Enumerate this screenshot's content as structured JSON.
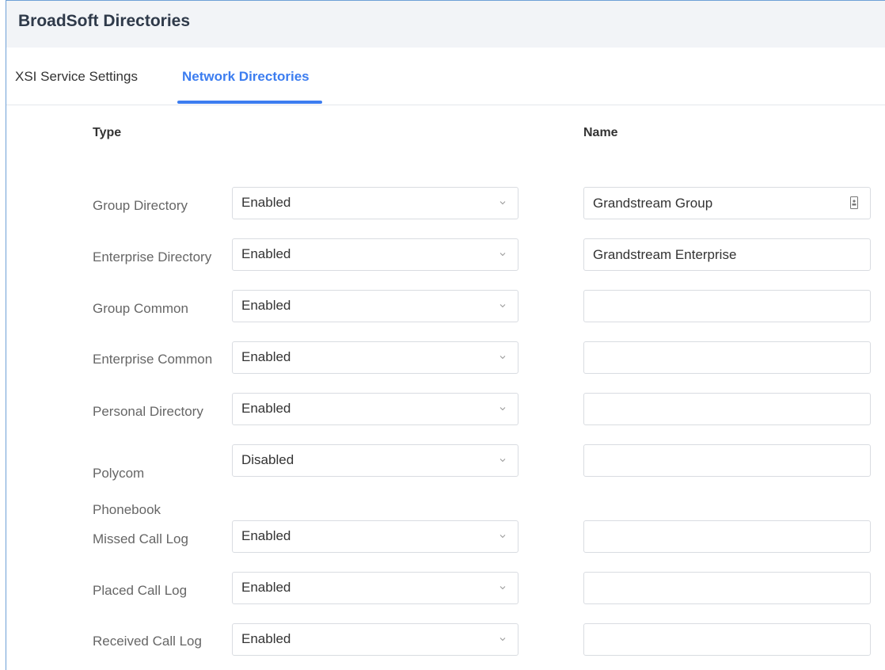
{
  "header": {
    "title": "BroadSoft Directories"
  },
  "tabs": [
    {
      "label": "XSI Service Settings",
      "active": false
    },
    {
      "label": "Network Directories",
      "active": true
    }
  ],
  "columns": {
    "type": "Type",
    "name": "Name"
  },
  "rows": [
    {
      "type": "Group Directory",
      "status": "Enabled",
      "name": "Grandstream Group"
    },
    {
      "type": "Enterprise Directory",
      "status": "Enabled",
      "name": "Grandstream Enterprise"
    },
    {
      "type": "Group Common",
      "status": "Enabled",
      "name": ""
    },
    {
      "type": "Enterprise Common",
      "status": "Enabled",
      "name": ""
    },
    {
      "type": "Personal Directory",
      "status": "Enabled",
      "name": ""
    },
    {
      "type": "Polycom Phonebook",
      "status": "Disabled",
      "name": ""
    },
    {
      "type": "Missed Call Log",
      "status": "Enabled",
      "name": ""
    },
    {
      "type": "Placed Call Log",
      "status": "Enabled",
      "name": ""
    },
    {
      "type": "Received Call Log",
      "status": "Enabled",
      "name": ""
    }
  ],
  "colors": {
    "accent": "#3c7df0",
    "frame": "#6ea0d6"
  },
  "icons": {
    "select": "chevron-down-icon",
    "field": "address-book-icon"
  }
}
